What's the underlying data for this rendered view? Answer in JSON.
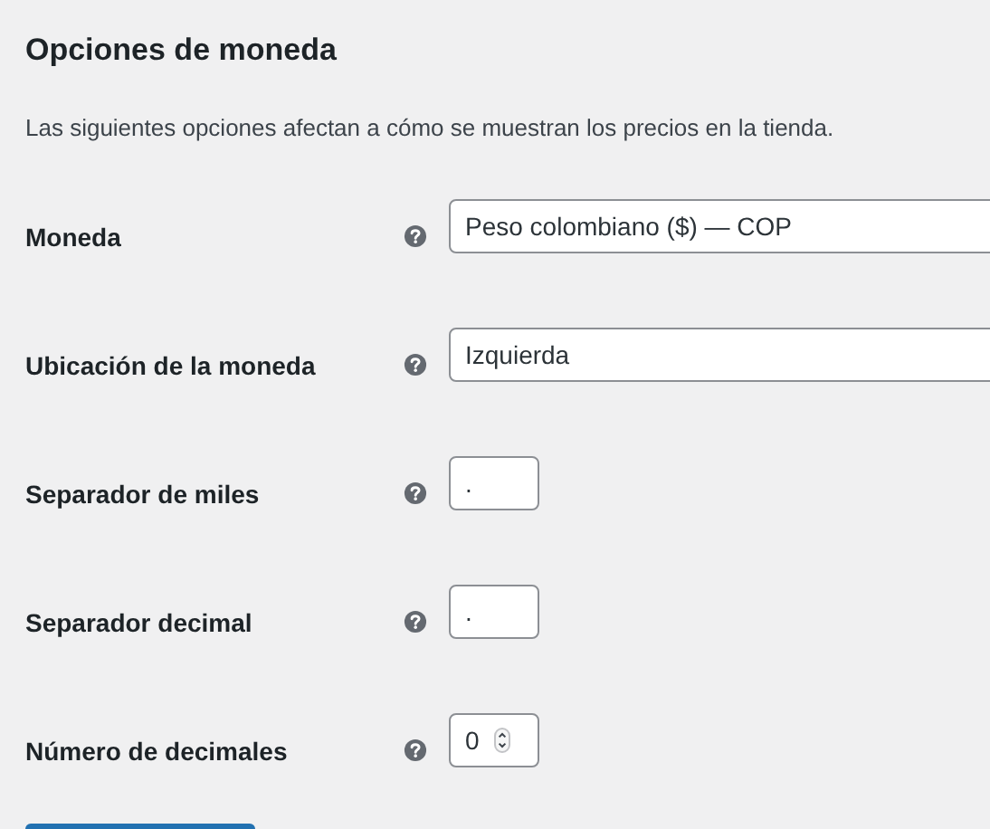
{
  "title": "Opciones de moneda",
  "description": "Las siguientes opciones afectan a cómo se muestran los precios en la tienda.",
  "fields": [
    {
      "label": "Moneda",
      "kind": "select",
      "value": "Peso colombiano ($) — COP"
    },
    {
      "label": "Ubicación de la moneda",
      "kind": "select",
      "value": "Izquierda"
    },
    {
      "label": "Separador de miles",
      "kind": "text",
      "value": "."
    },
    {
      "label": "Separador decimal",
      "kind": "text",
      "value": "."
    },
    {
      "label": "Número de decimales",
      "kind": "number",
      "value": "0"
    }
  ]
}
